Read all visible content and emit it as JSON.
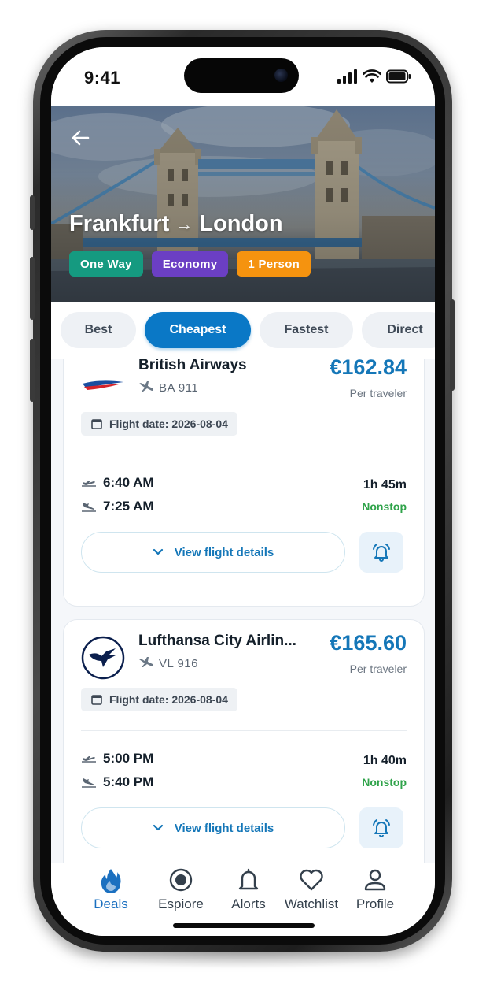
{
  "status_bar": {
    "time": "9:41"
  },
  "header": {
    "origin": "Frankfurt",
    "arrow": "→",
    "destination": "London",
    "chips": [
      {
        "label": "One Way",
        "color": "#159a80"
      },
      {
        "label": "Economy",
        "color": "#6b3fc4"
      },
      {
        "label": "1 Person",
        "color": "#f5930f"
      }
    ]
  },
  "sort_tabs": [
    {
      "label": "Best",
      "active": false
    },
    {
      "label": "Cheapest",
      "active": true
    },
    {
      "label": "Fastest",
      "active": false
    },
    {
      "label": "Direct",
      "active": false
    }
  ],
  "flights": [
    {
      "airline": "British Airways",
      "logo_icon": "british-airways-speedmarque-icon",
      "flight_number": "BA 911",
      "price": "€162.84",
      "price_note": "Per traveler",
      "flight_date": "Flight date: 2026-08-04",
      "departure": "6:40 AM",
      "arrival": "7:25 AM",
      "duration": "1h 45m",
      "stops": "Nonstop",
      "details_label": "View flight details"
    },
    {
      "airline": "Lufthansa City Airlin...",
      "logo_icon": "lufthansa-crane-icon",
      "flight_number": "VL 916",
      "price": "€165.60",
      "price_note": "Per traveler",
      "flight_date": "Flight date: 2026-08-04",
      "departure": "5:00 PM",
      "arrival": "5:40 PM",
      "duration": "1h 40m",
      "stops": "Nonstop",
      "details_label": "View flight details"
    }
  ],
  "bottom_nav": [
    {
      "label": "Deals",
      "icon": "flame-icon",
      "active": true
    },
    {
      "label": "Espiore",
      "icon": "explore-icon",
      "active": false
    },
    {
      "label": "Alorts",
      "icon": "bell-outline-icon",
      "active": false
    },
    {
      "label": "Watchlist",
      "icon": "heart-icon",
      "active": false
    },
    {
      "label": "Profile",
      "icon": "person-icon",
      "active": false
    }
  ],
  "colors": {
    "accent": "#0a78c6",
    "price": "#1577b8",
    "nonstop": "#2fa34a",
    "nav_active": "#1b70c0"
  }
}
